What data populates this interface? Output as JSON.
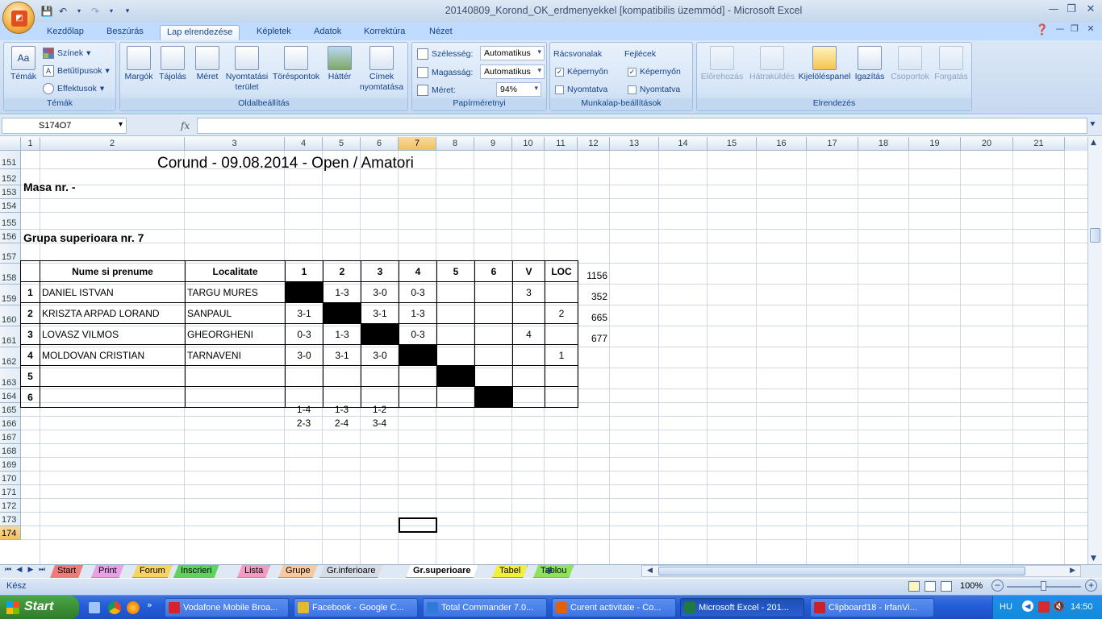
{
  "window": {
    "title": "20140809_Korond_OK_erdmenyekkel  [kompatibilis üzemmód] - Microsoft Excel"
  },
  "ribbon_tabs": [
    "Kezdőlap",
    "Beszúrás",
    "Lap elrendezése",
    "Képletek",
    "Adatok",
    "Korrektúra",
    "Nézet"
  ],
  "active_tab": "Lap elrendezése",
  "ribbon": {
    "temak": {
      "label": "Témák",
      "main": "Témák",
      "colors": "Színek",
      "fonts": "Betűtípusok",
      "effects": "Effektusok"
    },
    "oldalbeallitas": {
      "label": "Oldalbeállítás",
      "margins": "Margók",
      "orientation": "Tájolás",
      "size": "Méret",
      "print_area": "Nyomtatási terület",
      "breaks": "Töréspontok",
      "background": "Háttér",
      "titles": "Címek nyomtatása"
    },
    "papirmeret": {
      "label": "Papírméretnyi",
      "width_label": "Szélesség:",
      "width_value": "Automatikus",
      "height_label": "Magasság:",
      "height_value": "Automatikus",
      "scale_label": "Méret:",
      "scale_value": "94%"
    },
    "munkalap": {
      "label": "Munkalap-beállítások",
      "gridlines": "Rácsvonalak",
      "headings": "Fejlécek",
      "view": "Képernyőn",
      "print": "Nyomtatva"
    },
    "elrendezes": {
      "label": "Elrendezés",
      "bring_forward": "Előrehozás",
      "send_back": "Hátraküldés",
      "selection_pane": "Kijelöléspanel",
      "align": "Igazítás",
      "group": "Csoportok",
      "rotate": "Forgatás"
    }
  },
  "formula": {
    "name_box": "S174O7",
    "fx": "fx",
    "value": ""
  },
  "columns": [
    "1",
    "2",
    "3",
    "4",
    "5",
    "6",
    "7",
    "8",
    "9",
    "10",
    "11",
    "12",
    "13",
    "14",
    "15",
    "16",
    "17",
    "18",
    "19",
    "20",
    "21"
  ],
  "rows": [
    "151",
    "152",
    "153",
    "154",
    "155",
    "156",
    "157",
    "158",
    "159",
    "160",
    "161",
    "162",
    "163",
    "164",
    "165",
    "166",
    "167",
    "168",
    "169",
    "170",
    "171",
    "172",
    "173",
    "174"
  ],
  "sheet": {
    "title": "Corund - 09.08.2014 - Open / Amatori",
    "masa": "Masa nr.  -",
    "group_title": "Grupa superioara nr. 7",
    "table_header": {
      "name": "Nume si prenume",
      "city": "Localitate",
      "cols": [
        "1",
        "2",
        "3",
        "4",
        "5",
        "6"
      ],
      "v": "V",
      "loc": "LOC"
    },
    "players": [
      {
        "no": "1",
        "name": "DANIEL ISTVAN",
        "city": "TARGU MURES",
        "results": [
          "",
          "1-3",
          "3-0",
          "0-3",
          "",
          ""
        ],
        "v": "3",
        "loc": "",
        "side": "1156"
      },
      {
        "no": "2",
        "name": "KRISZTA ARPAD LORAND",
        "city": "SANPAUL",
        "results": [
          "3-1",
          "",
          "3-1",
          "1-3",
          "",
          ""
        ],
        "v": "",
        "loc": "2",
        "side": "352"
      },
      {
        "no": "3",
        "name": "LOVASZ VILMOS",
        "city": "GHEORGHENI",
        "results": [
          "0-3",
          "1-3",
          "",
          "0-3",
          "",
          ""
        ],
        "v": "4",
        "loc": "",
        "side": "665"
      },
      {
        "no": "4",
        "name": "MOLDOVAN CRISTIAN",
        "city": "TARNAVENI",
        "results": [
          "3-0",
          "3-1",
          "3-0",
          "",
          "",
          ""
        ],
        "v": "",
        "loc": "1",
        "side": "677"
      },
      {
        "no": "5",
        "name": "",
        "city": "",
        "results": [
          "",
          "",
          "",
          "",
          "",
          ""
        ],
        "v": "",
        "loc": "",
        "side": ""
      },
      {
        "no": "6",
        "name": "",
        "city": "",
        "results": [
          "",
          "",
          "",
          "",
          "",
          ""
        ],
        "v": "",
        "loc": "",
        "side": ""
      }
    ],
    "pairings_row1": [
      "1-4",
      "1-3",
      "1-2"
    ],
    "pairings_row2": [
      "2-3",
      "2-4",
      "3-4"
    ]
  },
  "sheet_tabs": [
    {
      "name": "Start",
      "color": "#f07b7b"
    },
    {
      "name": "Print",
      "color": "#e8a0e8"
    },
    {
      "name": "Forum",
      "color": "#f6d55c"
    },
    {
      "name": "Inscrieri",
      "color": "#5ed45e"
    },
    {
      "name": "Lista",
      "color": "#f29bc3"
    },
    {
      "name": "Grupe",
      "color": "#f7c9a1"
    },
    {
      "name": "Gr.inferioare",
      "color": "#d7dde6"
    },
    {
      "name": "Gr.superioare",
      "color": "#ffffff"
    },
    {
      "name": "Tabel",
      "color": "#f3ef3f"
    },
    {
      "name": "Tablou",
      "color": "#8de35c"
    }
  ],
  "status": {
    "ready": "Kész",
    "zoom": "100%"
  },
  "taskbar": {
    "start": "Start",
    "items": [
      "Vodafone Mobile Broa...",
      "Facebook - Google C...",
      "Total Commander 7.0...",
      "Curent activitate - Co...",
      "Microsoft Excel - 201...",
      "Clipboard18 - IrfanVi..."
    ],
    "lang": "HU",
    "clock": "14:50"
  }
}
